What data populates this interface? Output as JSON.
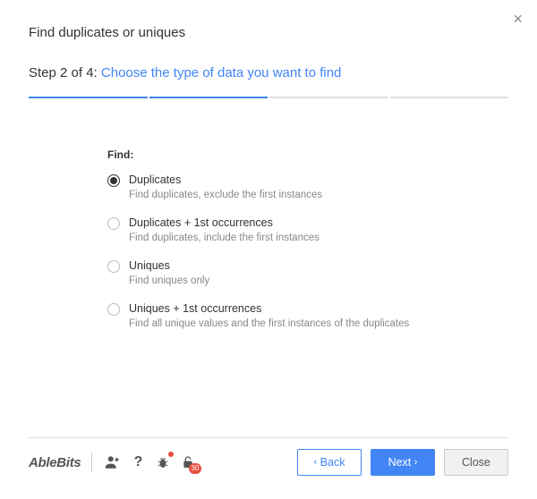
{
  "dialog": {
    "title": "Find duplicates or uniques",
    "step_prefix": "Step 2 of 4: ",
    "step_subtitle": "Choose the type of data you want to find"
  },
  "find": {
    "label": "Find:",
    "options": [
      {
        "label": "Duplicates",
        "desc": "Find duplicates, exclude the first instances",
        "selected": true
      },
      {
        "label": "Duplicates + 1st occurrences",
        "desc": "Find duplicates, include the first instances",
        "selected": false
      },
      {
        "label": "Uniques",
        "desc": "Find uniques only",
        "selected": false
      },
      {
        "label": "Uniques + 1st occurrences",
        "desc": "Find all unique values and the first instances of the duplicates",
        "selected": false
      }
    ]
  },
  "footer": {
    "brand": "AbleBits",
    "lock_badge": "30",
    "buttons": {
      "back": "Back",
      "next": "Next",
      "close": "Close"
    }
  }
}
